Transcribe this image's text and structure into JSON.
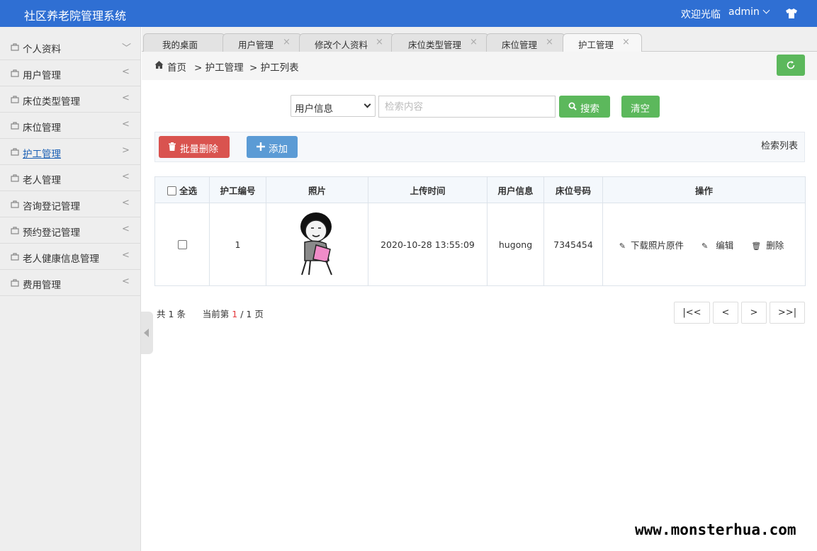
{
  "header": {
    "app_title": "社区养老院管理系统",
    "welcome": "欢迎光临",
    "username": "admin"
  },
  "sidebar": {
    "items": [
      {
        "label": "个人资料",
        "arrow": "﹀"
      },
      {
        "label": "用户管理",
        "arrow": "<"
      },
      {
        "label": "床位类型管理",
        "arrow": "<"
      },
      {
        "label": "床位管理",
        "arrow": "<"
      },
      {
        "label": "护工管理",
        "arrow": ">"
      },
      {
        "label": "老人管理",
        "arrow": "<"
      },
      {
        "label": "咨询登记管理",
        "arrow": "<"
      },
      {
        "label": "预约登记管理",
        "arrow": "<"
      },
      {
        "label": "老人健康信息管理",
        "arrow": "<"
      },
      {
        "label": "费用管理",
        "arrow": "<"
      }
    ]
  },
  "tabs": [
    {
      "label": "我的桌面",
      "close": ""
    },
    {
      "label": "用户管理",
      "close": "×"
    },
    {
      "label": "修改个人资料",
      "close": "×"
    },
    {
      "label": "床位类型管理",
      "close": "×"
    },
    {
      "label": "床位管理",
      "close": "×"
    },
    {
      "label": "护工管理",
      "close": "×"
    }
  ],
  "breadcrumb": {
    "home": "首页",
    "level1": "> 护工管理",
    "level2": ">  护工列表"
  },
  "search": {
    "field_selected": "用户信息",
    "placeholder": "检索内容",
    "search_label": "搜索",
    "clear_label": "清空"
  },
  "toolbar": {
    "batch_delete_label": "批量删除",
    "add_label": "添加",
    "list_title": "检索列表"
  },
  "table": {
    "headers": {
      "select_all": "全选",
      "id": "护工编号",
      "photo": "照片",
      "upload_time": "上传时间",
      "user_info": "用户信息",
      "bed_no": "床位号码",
      "ops": "操作"
    },
    "rows": [
      {
        "id": "1",
        "upload_time": "2020-10-28 13:55:09",
        "user_info": "hugong",
        "bed_no": "7345454",
        "download": "下载照片原件",
        "edit": "编辑",
        "delete": "删除"
      }
    ]
  },
  "pager": {
    "total_prefix": "共",
    "total": "1",
    "total_suffix": "条",
    "current_prefix": "当前第",
    "current": "1",
    "pages": "/ 1 页",
    "first": "|<<",
    "prev": "<",
    "next": ">",
    "last": ">>|"
  },
  "watermark": "www.monsterhua.com",
  "colors": {
    "header": "#2f6fd3",
    "success": "#5cb85c",
    "danger": "#d9534f",
    "primary": "#5b9bd5"
  }
}
